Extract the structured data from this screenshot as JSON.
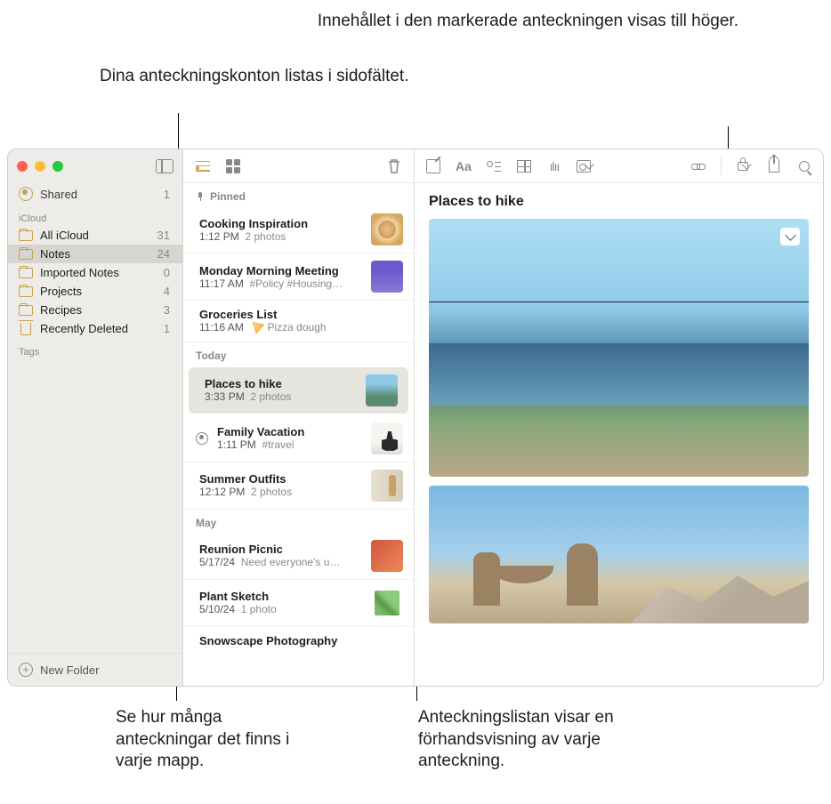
{
  "callouts": {
    "top_left": "Dina anteckningskonton listas i sidofältet.",
    "top_right": "Innehållet i den markerade anteckningen visas till höger.",
    "bottom_left": "Se hur många anteckningar det finns i varje mapp.",
    "bottom_right": "Anteckningslistan visar en förhandsvisning av varje anteckning."
  },
  "sidebar": {
    "shared_label": "Shared",
    "shared_count": "1",
    "section_icloud": "iCloud",
    "folders": [
      {
        "name": "All iCloud",
        "count": "31"
      },
      {
        "name": "Notes",
        "count": "24"
      },
      {
        "name": "Imported Notes",
        "count": "0"
      },
      {
        "name": "Projects",
        "count": "4"
      },
      {
        "name": "Recipes",
        "count": "3"
      },
      {
        "name": "Recently Deleted",
        "count": "1"
      }
    ],
    "section_tags": "Tags",
    "new_folder": "New Folder"
  },
  "notelist": {
    "groups": [
      {
        "label": "Pinned",
        "pinned": true,
        "notes": [
          {
            "title": "Cooking Inspiration",
            "time": "1:12 PM",
            "meta": "2 photos",
            "thumb": "pizza"
          },
          {
            "title": "Monday Morning Meeting",
            "time": "11:17 AM",
            "meta": "#Policy #Housing…",
            "thumb": "meeting"
          },
          {
            "title": "Groceries List",
            "time": "11:16 AM",
            "meta": "Pizza dough",
            "pizza_emoji": true
          }
        ]
      },
      {
        "label": "Today",
        "notes": [
          {
            "title": "Places to hike",
            "time": "3:33 PM",
            "meta": "2 photos",
            "thumb": "hike",
            "selected": true
          },
          {
            "title": "Family Vacation",
            "time": "1:11 PM",
            "meta": "#travel",
            "thumb": "bike",
            "shared": true
          },
          {
            "title": "Summer Outfits",
            "time": "12:12 PM",
            "meta": "2 photos",
            "thumb": "outfit"
          }
        ]
      },
      {
        "label": "May",
        "notes": [
          {
            "title": "Reunion Picnic",
            "time": "5/17/24",
            "meta": "Need everyone's u…",
            "thumb": "picnic"
          },
          {
            "title": "Plant Sketch",
            "time": "5/10/24",
            "meta": "1 photo",
            "thumb": "plant"
          },
          {
            "title": "Snowscape Photography",
            "time": "",
            "meta": ""
          }
        ]
      }
    ]
  },
  "detail": {
    "title": "Places to hike"
  }
}
